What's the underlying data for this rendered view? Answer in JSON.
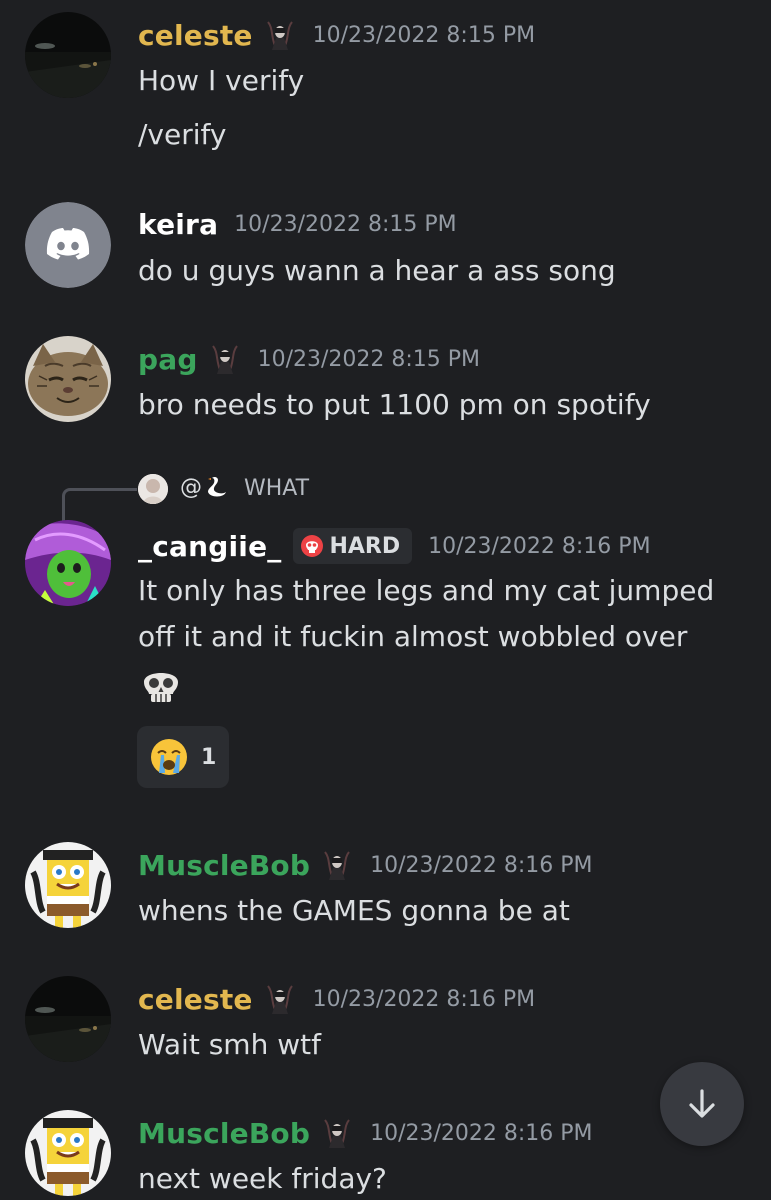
{
  "colors": {
    "background": "#1e1f22",
    "celeste": "#e2b74f",
    "keira": "#ffffff",
    "green_role": "#3ba55c",
    "cangiie": "#ffffff",
    "timestamp": "#949ba4",
    "text": "#dbdee1"
  },
  "messages": [
    {
      "author": "celeste",
      "avatar_icon": "night-road-avatar",
      "role_icon": "dark-figure-role-icon",
      "timestamp": "10/23/2022 8:15 PM",
      "lines": [
        "How I verify",
        "/verify"
      ]
    },
    {
      "author": "keira",
      "avatar_icon": "discord-default-avatar",
      "timestamp": "10/23/2022 8:15 PM",
      "lines": [
        "do u guys wann a hear a ass song"
      ]
    },
    {
      "author": "pag",
      "avatar_icon": "cat-avatar",
      "role_icon": "dark-figure-role-icon",
      "timestamp": "10/23/2022 8:15 PM",
      "lines": [
        "bro needs to put 1100 pm on spotify"
      ]
    },
    {
      "author": "_cangiie_",
      "avatar_icon": "anime-green-avatar",
      "badge": "HARD",
      "badge_icon": "skull-icon",
      "timestamp": "10/23/2022 8:16 PM",
      "lines": [
        "It only has three legs and my cat jumped",
        "off it and it fuckin almost wobbled over"
      ],
      "emoji": "skull-emoji",
      "reply": {
        "mention": "@",
        "mention_icon": "swan-emoji",
        "text": "WHAT"
      },
      "reaction": {
        "emoji": "crying-face-emoji",
        "count": "1"
      }
    },
    {
      "author": "MuscleBob",
      "avatar_icon": "spongebob-avatar",
      "role_icon": "dark-figure-role-icon",
      "timestamp": "10/23/2022 8:16 PM",
      "lines": [
        "whens the GAMES gonna be at"
      ]
    },
    {
      "author": "celeste",
      "avatar_icon": "night-road-avatar",
      "role_icon": "dark-figure-role-icon",
      "timestamp": "10/23/2022 8:16 PM",
      "lines": [
        "Wait smh wtf"
      ]
    },
    {
      "author": "MuscleBob",
      "avatar_icon": "spongebob-avatar",
      "role_icon": "dark-figure-role-icon",
      "timestamp": "10/23/2022 8:16 PM",
      "lines": [
        "next week friday?"
      ]
    }
  ],
  "scroll_button": {
    "icon": "arrow-down-icon"
  }
}
